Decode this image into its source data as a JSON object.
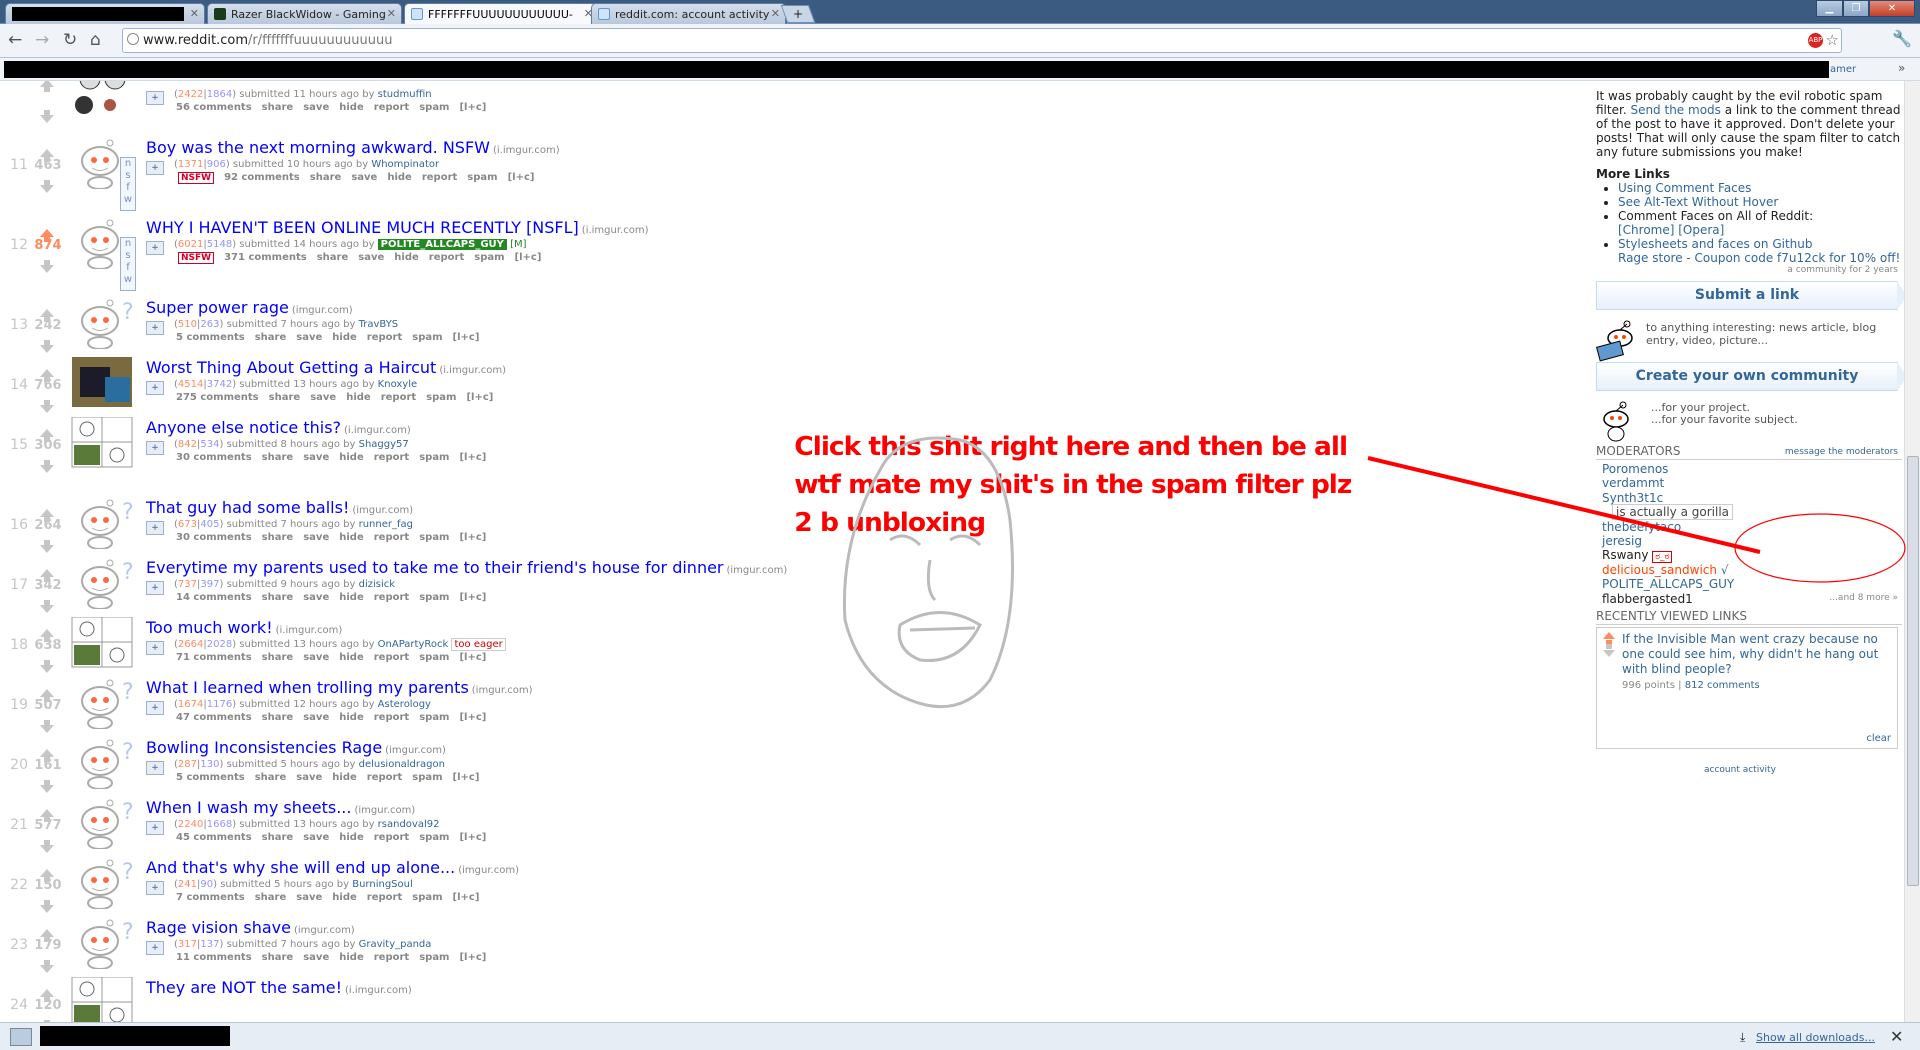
{
  "browser": {
    "tabs": [
      {
        "label": "",
        "redacted": true
      },
      {
        "label": "Razer BlackWidow - Gaming"
      },
      {
        "label": "FFFFFFFUUUUUUUUUUUU-"
      },
      {
        "label": "reddit.com: account activity"
      }
    ],
    "url_host": "www.reddit.com",
    "url_path": "/r/fffffffuuuuuuuuuuuu",
    "bookmark_fragment": "amer"
  },
  "posts": [
    {
      "rank": "",
      "score": "",
      "title": "",
      "domain": "",
      "ups": "2422",
      "downs": "1864",
      "age": "11 hours ago",
      "author": "studmuffin",
      "comments": "56 comments",
      "nsfw": false,
      "flair": ""
    },
    {
      "rank": "11",
      "score": "463",
      "title": "Boy was the next morning awkward. NSFW",
      "domain": "(i.imgur.com)",
      "ups": "1371",
      "downs": "906",
      "age": "10 hours ago",
      "author": "Whompinator",
      "comments": "92 comments",
      "nsfw": true,
      "flair": ""
    },
    {
      "rank": "12",
      "score": "874",
      "title": "WHY I HAVEN'T BEEN ONLINE MUCH RECENTLY [NSFL]",
      "domain": "(i.imgur.com)",
      "ups": "6021",
      "downs": "5148",
      "age": "14 hours ago",
      "author": "POLITE_ALLCAPS_GUY",
      "comments": "371 comments",
      "nsfw": true,
      "flair": "[M]"
    },
    {
      "rank": "13",
      "score": "242",
      "title": "Super power rage",
      "domain": "(imgur.com)",
      "ups": "510",
      "downs": "263",
      "age": "7 hours ago",
      "author": "TravBYS",
      "comments": "5 comments",
      "nsfw": false,
      "flair": ""
    },
    {
      "rank": "14",
      "score": "766",
      "title": "Worst Thing About Getting a Haircut",
      "domain": "(i.imgur.com)",
      "ups": "4514",
      "downs": "3742",
      "age": "13 hours ago",
      "author": "Knoxyle",
      "comments": "275 comments",
      "nsfw": false,
      "flair": ""
    },
    {
      "rank": "15",
      "score": "306",
      "title": "Anyone else notice this?",
      "domain": "(i.imgur.com)",
      "ups": "842",
      "downs": "534",
      "age": "8 hours ago",
      "author": "Shaggy57",
      "comments": "30 comments",
      "nsfw": false,
      "flair": ""
    },
    {
      "rank": "16",
      "score": "264",
      "title": "That guy had some balls!",
      "domain": "(imgur.com)",
      "ups": "673",
      "downs": "405",
      "age": "7 hours ago",
      "author": "runner_fag",
      "comments": "30 comments",
      "nsfw": false,
      "flair": ""
    },
    {
      "rank": "17",
      "score": "342",
      "title": "Everytime my parents used to take me to their friend's house for dinner",
      "domain": "(imgur.com)",
      "ups": "737",
      "downs": "397",
      "age": "9 hours ago",
      "author": "dizisick",
      "comments": "14 comments",
      "nsfw": false,
      "flair": ""
    },
    {
      "rank": "18",
      "score": "638",
      "title": "Too much work!",
      "domain": "(i.imgur.com)",
      "ups": "2664",
      "downs": "2028",
      "age": "13 hours ago",
      "author": "OnAPartyRock",
      "comments": "71 comments",
      "nsfw": false,
      "flair": "too eager"
    },
    {
      "rank": "19",
      "score": "507",
      "title": "What I learned when trolling my parents",
      "domain": "(imgur.com)",
      "ups": "1674",
      "downs": "1176",
      "age": "12 hours ago",
      "author": "Asterology",
      "comments": "47 comments",
      "nsfw": false,
      "flair": ""
    },
    {
      "rank": "20",
      "score": "161",
      "title": "Bowling Inconsistencies Rage",
      "domain": "(imgur.com)",
      "ups": "287",
      "downs": "130",
      "age": "5 hours ago",
      "author": "delusionaldragon",
      "comments": "5 comments",
      "nsfw": false,
      "flair": ""
    },
    {
      "rank": "21",
      "score": "577",
      "title": "When I wash my sheets...",
      "domain": "(imgur.com)",
      "ups": "2240",
      "downs": "1668",
      "age": "13 hours ago",
      "author": "rsandoval92",
      "comments": "45 comments",
      "nsfw": false,
      "flair": ""
    },
    {
      "rank": "22",
      "score": "150",
      "title": "And that's why she will end up alone...",
      "domain": "(imgur.com)",
      "ups": "241",
      "downs": "90",
      "age": "5 hours ago",
      "author": "BurningSoul",
      "comments": "7 comments",
      "nsfw": false,
      "flair": ""
    },
    {
      "rank": "23",
      "score": "179",
      "title": "Rage vision shave",
      "domain": "(imgur.com)",
      "ups": "317",
      "downs": "137",
      "age": "7 hours ago",
      "author": "Gravity_panda",
      "comments": "11 comments",
      "nsfw": false,
      "flair": ""
    },
    {
      "rank": "24",
      "score": "120",
      "title": "They are NOT the same!",
      "domain": "(i.imgur.com)",
      "ups": "",
      "downs": "",
      "age": "",
      "author": "",
      "comments": "",
      "nsfw": false,
      "flair": ""
    }
  ],
  "post_actions": {
    "submitted": "submitted",
    "by": "by",
    "share": "share",
    "save": "save",
    "hide": "hide",
    "report": "report",
    "spam": "spam",
    "lc": "[l+c]",
    "nsfw_stamp": "NSFW",
    "nsfw_tag": "nsfw",
    "expando": "+"
  },
  "sidebar": {
    "spam_text_1": "It was probably caught by the evil robotic spam filter. ",
    "spam_link": "Send the mods",
    "spam_text_2": " a link to the comment thread of the post to have it approved. Don't delete your posts! That will only cause the spam filter to catch any future submissions you make!",
    "more_links_title": "More Links",
    "more_links": [
      "Using Comment Faces",
      "See Alt-Text Without Hover",
      "Comment Faces on All of Reddit:",
      "[Chrome] [Opera]",
      "Stylesheets and faces on Github",
      "Rage store - Coupon code f7u12ck for 10% off!"
    ],
    "community_age": "a community for 2 years",
    "submit_link": "Submit a link",
    "submit_note": "to anything interesting: news article, blog entry, video, picture...",
    "create_community": "Create your own community",
    "create_note_1": "...for your project.",
    "create_note_2": "...for your favorite subject.",
    "moderators_title": "MODERATORS",
    "message_mods": "message the moderators",
    "moderators": [
      "Poromenos",
      "verdammt",
      "Synth3t1c",
      "is actually a gorilla",
      "thebeefytaco",
      "jeresig",
      "Rswany",
      "delicious_sandwich",
      "POLITE_ALLCAPS_GUY",
      "flabbergasted1"
    ],
    "more_mods": "...and 8 more »",
    "recent_title": "RECENTLY VIEWED LINKS",
    "recent_link": "If the Invisible Man went crazy because no one could see him, why didn't he hang out with blind people?",
    "recent_points": "996 points",
    "recent_comments": "812 comments",
    "clear": "clear",
    "account_activity": "account activity"
  },
  "annotation": {
    "line1": "Click this shit right here and then be all",
    "line2": "wtf mate my shit's in the spam filter plz",
    "line3": "2 b unbloxing"
  },
  "statusbar": {
    "downloads": "Show all downloads..."
  },
  "colors": {
    "link": "#0000ff",
    "upvote": "#ff8b60",
    "downvote": "#9494ff",
    "annotation": "#ff0000"
  }
}
